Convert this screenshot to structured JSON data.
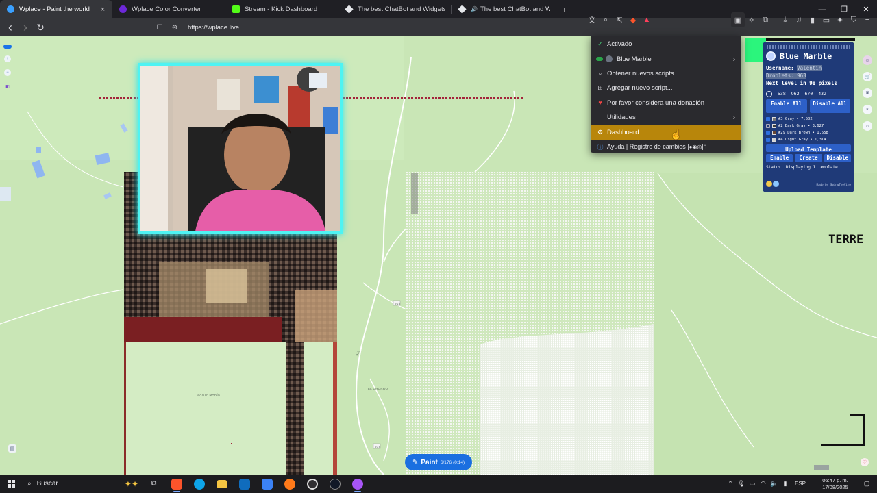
{
  "browser": {
    "tabs": [
      {
        "title": "Wplace - Paint the world",
        "active": true,
        "favicon": "#3aa0ff"
      },
      {
        "title": "Wplace Color Converter",
        "active": false,
        "favicon": "#6d28d9"
      },
      {
        "title": "Stream - Kick Dashboard",
        "active": false,
        "favicon": "#53fc18"
      },
      {
        "title": "The best ChatBot and Widgets for Ki",
        "active": false,
        "favicon": "#e5e7eb"
      },
      {
        "title": "The best ChatBot and Widgets fo",
        "active": false,
        "favicon": "#e5e7eb"
      }
    ],
    "close_glyph": "×",
    "new_tab_glyph": "+",
    "window": {
      "minimize": "—",
      "restore": "❐",
      "close": "✕"
    },
    "url": "https://wplace.live",
    "nav": {
      "back": "‹",
      "forward": "›",
      "reload": "↻",
      "bookmark": "☐",
      "site_info": "⊜"
    }
  },
  "extension_menu": {
    "items": [
      {
        "label": "Activado",
        "icon": "check-icon",
        "glyph": "✓",
        "submenu": false
      },
      {
        "label": "Blue Marble",
        "icon": "script-toggle",
        "glyph": "",
        "submenu": true
      },
      {
        "label": "Obtener nuevos scripts...",
        "icon": "search-icon",
        "glyph": "🔍",
        "submenu": false
      },
      {
        "label": "Agregar nuevo script...",
        "icon": "plus-square-icon",
        "glyph": "⊞",
        "submenu": false
      },
      {
        "label": "Por favor considera una donación",
        "icon": "heart-icon",
        "glyph": "♥",
        "submenu": false
      },
      {
        "label": "Utilidades",
        "icon": "",
        "glyph": "",
        "submenu": true
      },
      {
        "label": "Dashboard",
        "icon": "gear-icon",
        "glyph": "⚙",
        "submenu": false,
        "hover": true
      },
      {
        "label": "Ayuda | Registro de cambios | ",
        "icon": "info-icon",
        "glyph": "ⓘ",
        "submenu": false
      }
    ],
    "submenu_arrow": "›"
  },
  "blue_marble": {
    "title": "Blue Marble",
    "username_label": "Username: ",
    "username_value": "Valentin",
    "droplets_label": "Droplets: ",
    "droplets_value": "963",
    "next_level": "Next level in 98 pixels",
    "stats": [
      "538",
      "962",
      "670",
      "432"
    ],
    "enable_all": "Enable All",
    "disable_all": "Disable All",
    "colors": [
      {
        "label": "#3 Gray • 7,502",
        "swatch": "#787878",
        "checked": true
      },
      {
        "label": "#2 Dark Gray • 3,627",
        "swatch": "#3c3c3c",
        "checked": false
      },
      {
        "label": "#29 Dark Brown • 1,558",
        "swatch": "#684634",
        "checked": true
      },
      {
        "label": "#4 Light Gray • 1,314",
        "swatch": "#d2d2d2",
        "checked": true
      }
    ],
    "upload_template": "Upload Template",
    "enable": "Enable",
    "create": "Create",
    "disable": "Disable",
    "status": "Status: Displaying 1 template.",
    "footer": "Made by SwingTheVine"
  },
  "map": {
    "labels": {
      "santa_maria": "SANTA MARÍA",
      "el_chorro": "EL CHORRO",
      "r918a": "918",
      "r918b": "918",
      "r918c": "918"
    },
    "terre_text": "TERRE",
    "paint_label": "Paint",
    "paint_count": "6/176",
    "paint_timer": "(0:14)",
    "colors": {
      "land": "#c8e6b4",
      "road": "#ffffff",
      "accent": "#1a6fe0"
    }
  },
  "taskbar": {
    "search_placeholder": "Buscar",
    "language": "ESP",
    "time": "06:47 p. m.",
    "date": "17/08/2025",
    "apps": [
      {
        "name": "task-view",
        "color": "#9ca3af"
      },
      {
        "name": "brave",
        "color": "#fb542b"
      },
      {
        "name": "edge",
        "color": "#0ea5e9"
      },
      {
        "name": "explorer",
        "color": "#f5c542"
      },
      {
        "name": "outlook",
        "color": "#0f6cbd"
      },
      {
        "name": "store",
        "color": "#3b82f6"
      },
      {
        "name": "firefox",
        "color": "#ff7a1a"
      },
      {
        "name": "obs",
        "color": "#302e31"
      },
      {
        "name": "streamer-app",
        "color": "#111827"
      },
      {
        "name": "chrome-like",
        "color": "#a855f7"
      }
    ]
  }
}
